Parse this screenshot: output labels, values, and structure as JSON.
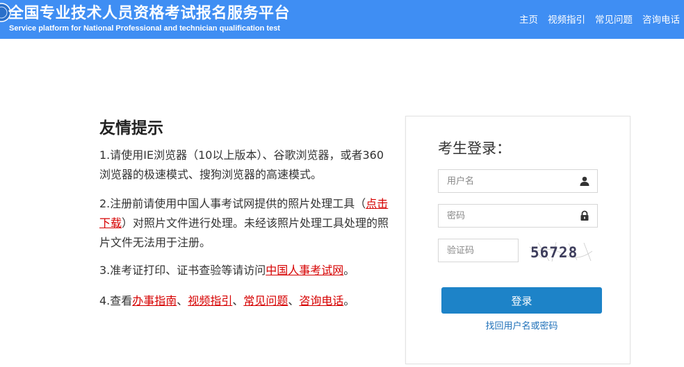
{
  "header": {
    "title": "全国专业技术人员资格考试报名服务平台",
    "subtitle": "Service platform for National Professional and technician qualification test",
    "nav": [
      "主页",
      "视频指引",
      "常见问题",
      "咨询电话"
    ],
    "bg_color": "#3f8ef3"
  },
  "tips": {
    "title": "友情提示",
    "item1": "1.请使用IE浏览器（10以上版本）、谷歌浏览器，或者360浏览器的极速模式、搜狗浏览器的高速模式。",
    "item2_a": "2.注册前请使用中国人事考试网提供的照片处理工具（",
    "item2_link": "点击下载",
    "item2_b": "）对照片文件进行处理。未经该照片处理工具处理的照片文件无法用于注册。",
    "item3_a": "3.准考证打印、证书查验等请访问",
    "item3_link": "中国人事考试网",
    "item3_b": "。",
    "item4_a": "4.查看",
    "item4_links": [
      "办事指南",
      "视频指引",
      "常见问题",
      "咨询电话"
    ],
    "item4_sep": "、",
    "item4_end": "。",
    "link_color": "#d60000"
  },
  "login": {
    "title": "考生登录：",
    "username_placeholder": "用户名",
    "password_placeholder": "密码",
    "captcha_placeholder": "验证码",
    "captcha_text": "56728",
    "submit_label": "登录",
    "forgot_label": "找回用户名或密码",
    "button_color": "#1d83c8"
  }
}
